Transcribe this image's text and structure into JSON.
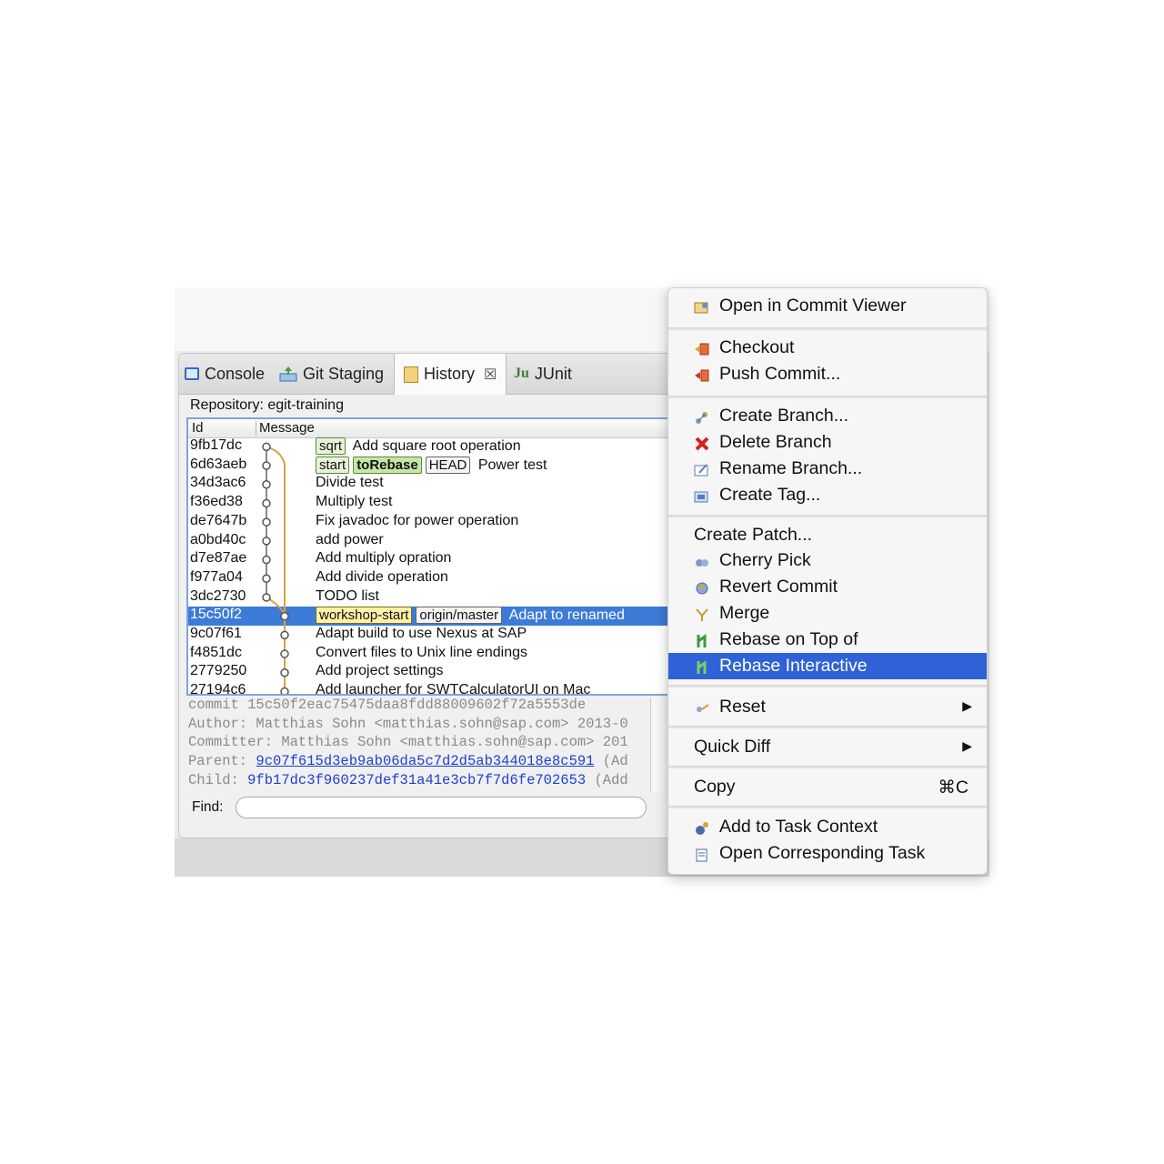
{
  "tabs": [
    {
      "label": "Console",
      "icon": "console-icon"
    },
    {
      "label": "Git Staging",
      "icon": "git-staging-icon"
    },
    {
      "label": "History",
      "icon": "history-icon"
    },
    {
      "label": "JUnit",
      "icon": "junit-icon"
    }
  ],
  "history": {
    "repository_label": "Repository: egit-training",
    "columns": {
      "id": "Id",
      "message": "Message"
    },
    "rows": [
      {
        "id": "9fb17dc",
        "refs": [
          "sqrt"
        ],
        "message": "Add square root operation"
      },
      {
        "id": "6d63aeb",
        "refs": [
          "start",
          "toRebase",
          "HEAD"
        ],
        "message": "Power test"
      },
      {
        "id": "34d3ac6",
        "refs": [],
        "message": "Divide test"
      },
      {
        "id": "f36ed38",
        "refs": [],
        "message": "Multiply test"
      },
      {
        "id": "de7647b",
        "refs": [],
        "message": "Fix javadoc for power operation"
      },
      {
        "id": "a0bd40c",
        "refs": [],
        "message": "add power"
      },
      {
        "id": "d7e87ae",
        "refs": [],
        "message": "Add multiply opration"
      },
      {
        "id": "f977a04",
        "refs": [],
        "message": "Add divide operation"
      },
      {
        "id": "3dc2730",
        "refs": [],
        "message": "TODO list"
      },
      {
        "id": "15c50f2",
        "refs": [
          "workshop-start",
          "origin/master"
        ],
        "message": "Adapt to renamed"
      },
      {
        "id": "9c07f61",
        "refs": [],
        "message": "Adapt build to use Nexus at SAP"
      },
      {
        "id": "f4851dc",
        "refs": [],
        "message": "Convert files to Unix line endings"
      },
      {
        "id": "2779250",
        "refs": [],
        "message": "Add project settings"
      },
      {
        "id": "27194c6",
        "refs": [],
        "message": "Add launcher for SWTCalculatorUI on Mac"
      }
    ],
    "selected_row": "15c50f2",
    "details": {
      "commit": "commit 15c50f2eac75475daa8fdd88009602f72a5553de",
      "author": "Author: Matthias Sohn <matthias.sohn@sap.com> 2013-0",
      "committer": "Committer: Matthias Sohn <matthias.sohn@sap.com> 201",
      "parent_label": "Parent: ",
      "parent_hash": "9c07f615d3eb9ab06da5c7d2d5ab344018e8c591",
      "parent_suffix": " (Ad",
      "child_label": "Child: ",
      "child_hash": "9fb17dc3f960237def31a41e3cb7f7d6fe702653",
      "child_suffix": " (Add"
    },
    "find_label": "Find:",
    "find_value": ""
  },
  "context_menu": {
    "items": [
      {
        "label": "Open in Commit Viewer",
        "icon": "commit-viewer-icon"
      },
      {
        "label": "Checkout",
        "icon": "checkout-icon"
      },
      {
        "label": "Push Commit...",
        "icon": "push-icon"
      },
      {
        "label": "Create Branch...",
        "icon": "create-branch-icon"
      },
      {
        "label": "Delete Branch",
        "icon": "delete-icon"
      },
      {
        "label": "Rename Branch...",
        "icon": "rename-icon"
      },
      {
        "label": "Create Tag...",
        "icon": "tag-icon"
      },
      {
        "label": "Create Patch...",
        "icon": ""
      },
      {
        "label": "Cherry Pick",
        "icon": "cherry-pick-icon"
      },
      {
        "label": "Revert Commit",
        "icon": "revert-icon"
      },
      {
        "label": "Merge",
        "icon": "merge-icon"
      },
      {
        "label": "Rebase on Top of",
        "icon": "rebase-icon"
      },
      {
        "label": "Rebase Interactive",
        "icon": "rebase-interactive-icon"
      },
      {
        "label": "Reset",
        "icon": "reset-icon"
      },
      {
        "label": "Quick Diff",
        "icon": ""
      },
      {
        "label": "Copy",
        "icon": "",
        "shortcut": "⌘C"
      },
      {
        "label": "Add to Task Context",
        "icon": "task-context-icon"
      },
      {
        "label": "Open Corresponding Task",
        "icon": "task-icon"
      }
    ],
    "highlighted": "Rebase Interactive"
  },
  "colors": {
    "selection": "#3d7bd8",
    "menu_highlight": "#2f62d6",
    "link": "#1f3fd0",
    "graph_line": "#d8a23a"
  }
}
